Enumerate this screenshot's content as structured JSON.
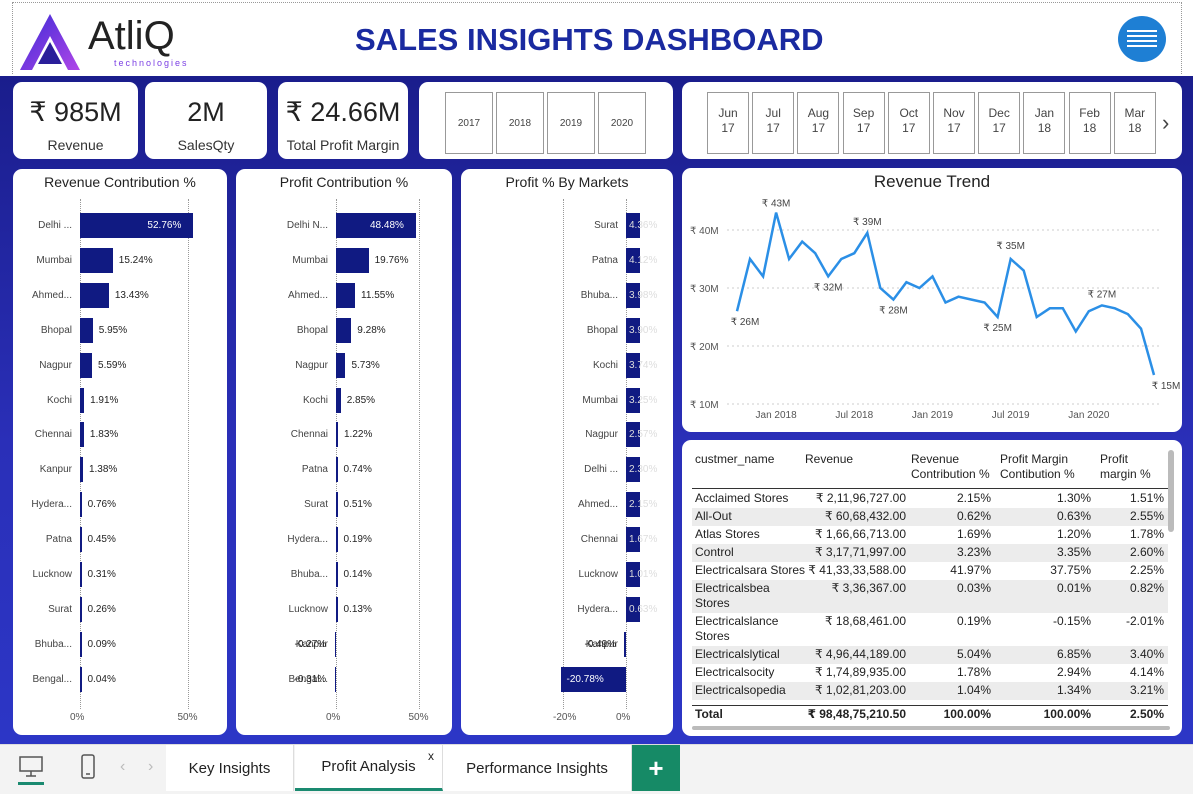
{
  "header": {
    "logo_name": "AtliQ",
    "logo_sub": "technologies",
    "title": "SALES INSIGHTS DASHBOARD"
  },
  "kpis": [
    {
      "value": "₹ 985M",
      "label": "Revenue"
    },
    {
      "value": "2M",
      "label": "SalesQty"
    },
    {
      "value": "₹ 24.66M",
      "label": "Total Profit Margin"
    }
  ],
  "years": [
    "2017",
    "2018",
    "2019",
    "2020"
  ],
  "months": [
    [
      "Jun",
      "17"
    ],
    [
      "Jul",
      "17"
    ],
    [
      "Aug",
      "17"
    ],
    [
      "Sep",
      "17"
    ],
    [
      "Oct",
      "17"
    ],
    [
      "Nov",
      "17"
    ],
    [
      "Dec",
      "17"
    ],
    [
      "Jan",
      "18"
    ],
    [
      "Feb",
      "18"
    ],
    [
      "Mar",
      "18"
    ]
  ],
  "chart_data": [
    {
      "type": "bar",
      "title": "Revenue Contribution %",
      "categories": [
        "Delhi ...",
        "Mumbai",
        "Ahmed...",
        "Bhopal",
        "Nagpur",
        "Kochi",
        "Chennai",
        "Kanpur",
        "Hydera...",
        "Patna",
        "Lucknow",
        "Surat",
        "Bhuba...",
        "Bengal..."
      ],
      "values": [
        52.76,
        15.24,
        13.43,
        5.95,
        5.59,
        1.91,
        1.83,
        1.38,
        0.76,
        0.45,
        0.31,
        0.26,
        0.09,
        0.04
      ],
      "labels": [
        "52.76%",
        "15.24%",
        "13.43%",
        "5.95%",
        "5.59%",
        "1.91%",
        "1.83%",
        "1.38%",
        "0.76%",
        "0.45%",
        "0.31%",
        "0.26%",
        "0.09%",
        "0.04%"
      ],
      "xticks": [
        "0%",
        "50%"
      ],
      "xlim": [
        0,
        60
      ]
    },
    {
      "type": "bar",
      "title": "Profit Contribution %",
      "categories": [
        "Delhi N...",
        "Mumbai",
        "Ahmed...",
        "Bhopal",
        "Nagpur",
        "Kochi",
        "Chennai",
        "Patna",
        "Surat",
        "Hydera...",
        "Bhuba...",
        "Lucknow",
        "Kanpur",
        "Bengal..."
      ],
      "values": [
        48.48,
        19.76,
        11.55,
        9.28,
        5.73,
        2.85,
        1.22,
        0.74,
        0.51,
        0.19,
        0.14,
        0.13,
        -0.27,
        -0.31
      ],
      "labels": [
        "48.48%",
        "19.76%",
        "11.55%",
        "9.28%",
        "5.73%",
        "2.85%",
        "1.22%",
        "0.74%",
        "0.51%",
        "0.19%",
        "0.14%",
        "0.13%",
        "-0.27%",
        "-0.31%"
      ],
      "xticks": [
        "0%",
        "50%"
      ],
      "xlim": [
        0,
        60
      ]
    },
    {
      "type": "bar",
      "title": "Profit % By Markets",
      "categories": [
        "Surat",
        "Patna",
        "Bhuba...",
        "Bhopal",
        "Kochi",
        "Mumbai",
        "Nagpur",
        "Delhi ...",
        "Ahmed...",
        "Chennai",
        "Lucknow",
        "Hydera...",
        "Kanpur",
        "Bengal..."
      ],
      "values": [
        4.36,
        4.12,
        3.98,
        3.9,
        3.74,
        3.25,
        2.57,
        2.3,
        2.15,
        1.67,
        1.01,
        0.63,
        -0.49,
        -20.78
      ],
      "labels": [
        "4.36%",
        "4.12%",
        "3.98%",
        "3.90%",
        "3.74%",
        "3.25%",
        "2.57%",
        "2.30%",
        "2.15%",
        "1.67%",
        "1.01%",
        "0.63%",
        "-0.49%",
        "-20.78%"
      ],
      "xticks": [
        "-20%",
        "0%"
      ],
      "xlim": [
        -25,
        6
      ]
    },
    {
      "type": "line",
      "title": "Revenue Trend",
      "yticks": [
        "₹ 40M",
        "₹ 30M",
        "₹ 20M",
        "₹ 10M"
      ],
      "ylim": [
        10,
        40
      ],
      "xticks": [
        "Jan 2018",
        "Jul 2018",
        "Jan 2019",
        "Jul 2019",
        "Jan 2020"
      ],
      "x": [
        "Oct 2017",
        "Nov 2017",
        "Dec 2017",
        "Jan 2018",
        "Feb 2018",
        "Mar 2018",
        "Apr 2018",
        "May 2018",
        "Jun 2018",
        "Jul 2018",
        "Aug 2018",
        "Sep 2018",
        "Oct 2018",
        "Nov 2018",
        "Dec 2018",
        "Jan 2019",
        "Feb 2019",
        "Mar 2019",
        "Apr 2019",
        "May 2019",
        "Jun 2019",
        "Jul 2019",
        "Aug 2019",
        "Sep 2019",
        "Oct 2019",
        "Nov 2019",
        "Dec 2019",
        "Jan 2020",
        "Feb 2020",
        "Mar 2020",
        "Apr 2020",
        "May 2020",
        "Jun 2020"
      ],
      "values": [
        26,
        35,
        32,
        43,
        35,
        38,
        36,
        32,
        35,
        36,
        39.5,
        30,
        28,
        31,
        30,
        32,
        27.5,
        28.5,
        28,
        27.5,
        25,
        35,
        33,
        25,
        26.5,
        26.5,
        22.5,
        26,
        27,
        26.5,
        25.5,
        23,
        15
      ],
      "annotations": [
        "₹ 43M",
        "₹ 26M",
        "₹ 32M",
        "₹ 39M",
        "₹ 28M",
        "₹ 35M",
        "₹ 25M",
        "₹ 27M",
        "₹ 15M"
      ]
    }
  ],
  "table": {
    "headers": [
      "custmer_name",
      "Revenue",
      "Revenue Contribution %",
      "Profit Margin Contibution %",
      "Profit margin %"
    ],
    "rows": [
      [
        "Acclaimed Stores",
        "₹ 2,11,96,727.00",
        "2.15%",
        "1.30%",
        "1.51%"
      ],
      [
        "All-Out",
        "₹ 60,68,432.00",
        "0.62%",
        "0.63%",
        "2.55%"
      ],
      [
        "Atlas Stores",
        "₹ 1,66,66,713.00",
        "1.69%",
        "1.20%",
        "1.78%"
      ],
      [
        "Control",
        "₹ 3,17,71,997.00",
        "3.23%",
        "3.35%",
        "2.60%"
      ],
      [
        "Electricalsara Stores",
        "₹ 41,33,33,588.00",
        "41.97%",
        "37.75%",
        "2.25%"
      ],
      [
        "Electricalsbea Stores",
        "₹ 3,36,367.00",
        "0.03%",
        "0.01%",
        "0.82%"
      ],
      [
        "Electricalslance Stores",
        "₹ 18,68,461.00",
        "0.19%",
        "-0.15%",
        "-2.01%"
      ],
      [
        "Electricalslytical",
        "₹ 4,96,44,189.00",
        "5.04%",
        "6.85%",
        "3.40%"
      ],
      [
        "Electricalsocity",
        "₹ 1,74,89,935.00",
        "1.78%",
        "2.94%",
        "4.14%"
      ],
      [
        "Electricalsopedia",
        "₹ 1,02,81,203.00",
        "1.04%",
        "1.34%",
        "3.21%"
      ]
    ],
    "total": [
      "Total",
      "₹ 98,48,75,210.50",
      "100.00%",
      "100.00%",
      "2.50%"
    ]
  },
  "tabs": {
    "items": [
      "Key Insights",
      "Profit Analysis",
      "Performance Insights"
    ],
    "active": "Profit Analysis",
    "close": "x",
    "add": "+"
  }
}
